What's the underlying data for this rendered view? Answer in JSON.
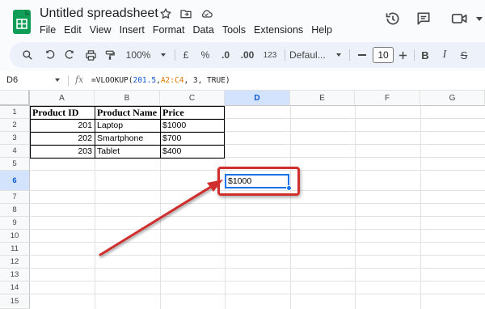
{
  "app": {
    "title": "Untitled spreadsheet",
    "menu": [
      "File",
      "Edit",
      "View",
      "Insert",
      "Format",
      "Data",
      "Tools",
      "Extensions",
      "Help"
    ]
  },
  "toolbar": {
    "zoom": "100%",
    "currency": "£",
    "percent": "%",
    "decrease_decimal": ".0",
    "increase_decimal": ".00",
    "number_format": "123",
    "font": "Defaul...",
    "font_size": "10",
    "bold": "B",
    "italic": "I",
    "strike": "S"
  },
  "formula_bar": {
    "cell_ref": "D6",
    "fx": "fx",
    "formula_prefix": "=VLOOKUP(",
    "formula_lookup": "201.5",
    "formula_comma1": ",",
    "formula_range": "A2:C4",
    "formula_rest": ", 3, TRUE)"
  },
  "grid": {
    "columns": [
      "A",
      "B",
      "C",
      "D",
      "E",
      "F",
      "G"
    ],
    "rows": [
      "1",
      "2",
      "3",
      "4",
      "5",
      "6",
      "7",
      "8",
      "9",
      "10",
      "11",
      "12",
      "13",
      "14",
      "15"
    ],
    "selected_column": "D",
    "selected_row": "6",
    "table": {
      "headers": [
        "Product ID",
        "Product Name",
        "Price"
      ],
      "rows": [
        [
          "201",
          "Laptop",
          "$1000"
        ],
        [
          "202",
          "Smartphone",
          "$700"
        ],
        [
          "203",
          "Tablet",
          "$400"
        ]
      ]
    },
    "result_cell_value": "$1000"
  },
  "colors": {
    "accent": "#1a73e8",
    "annotation": "#d12e2e",
    "sheets_green": "#0f9d58"
  },
  "icons": [
    "sheets-logo-icon",
    "star-icon",
    "move-to-folder-icon",
    "cloud-status-icon",
    "history-icon",
    "comment-icon",
    "video-call-icon",
    "search-icon",
    "undo-icon",
    "redo-icon",
    "print-icon",
    "paint-format-icon",
    "chevron-down-icon",
    "minus-icon",
    "plus-icon",
    "strikethrough-icon"
  ]
}
